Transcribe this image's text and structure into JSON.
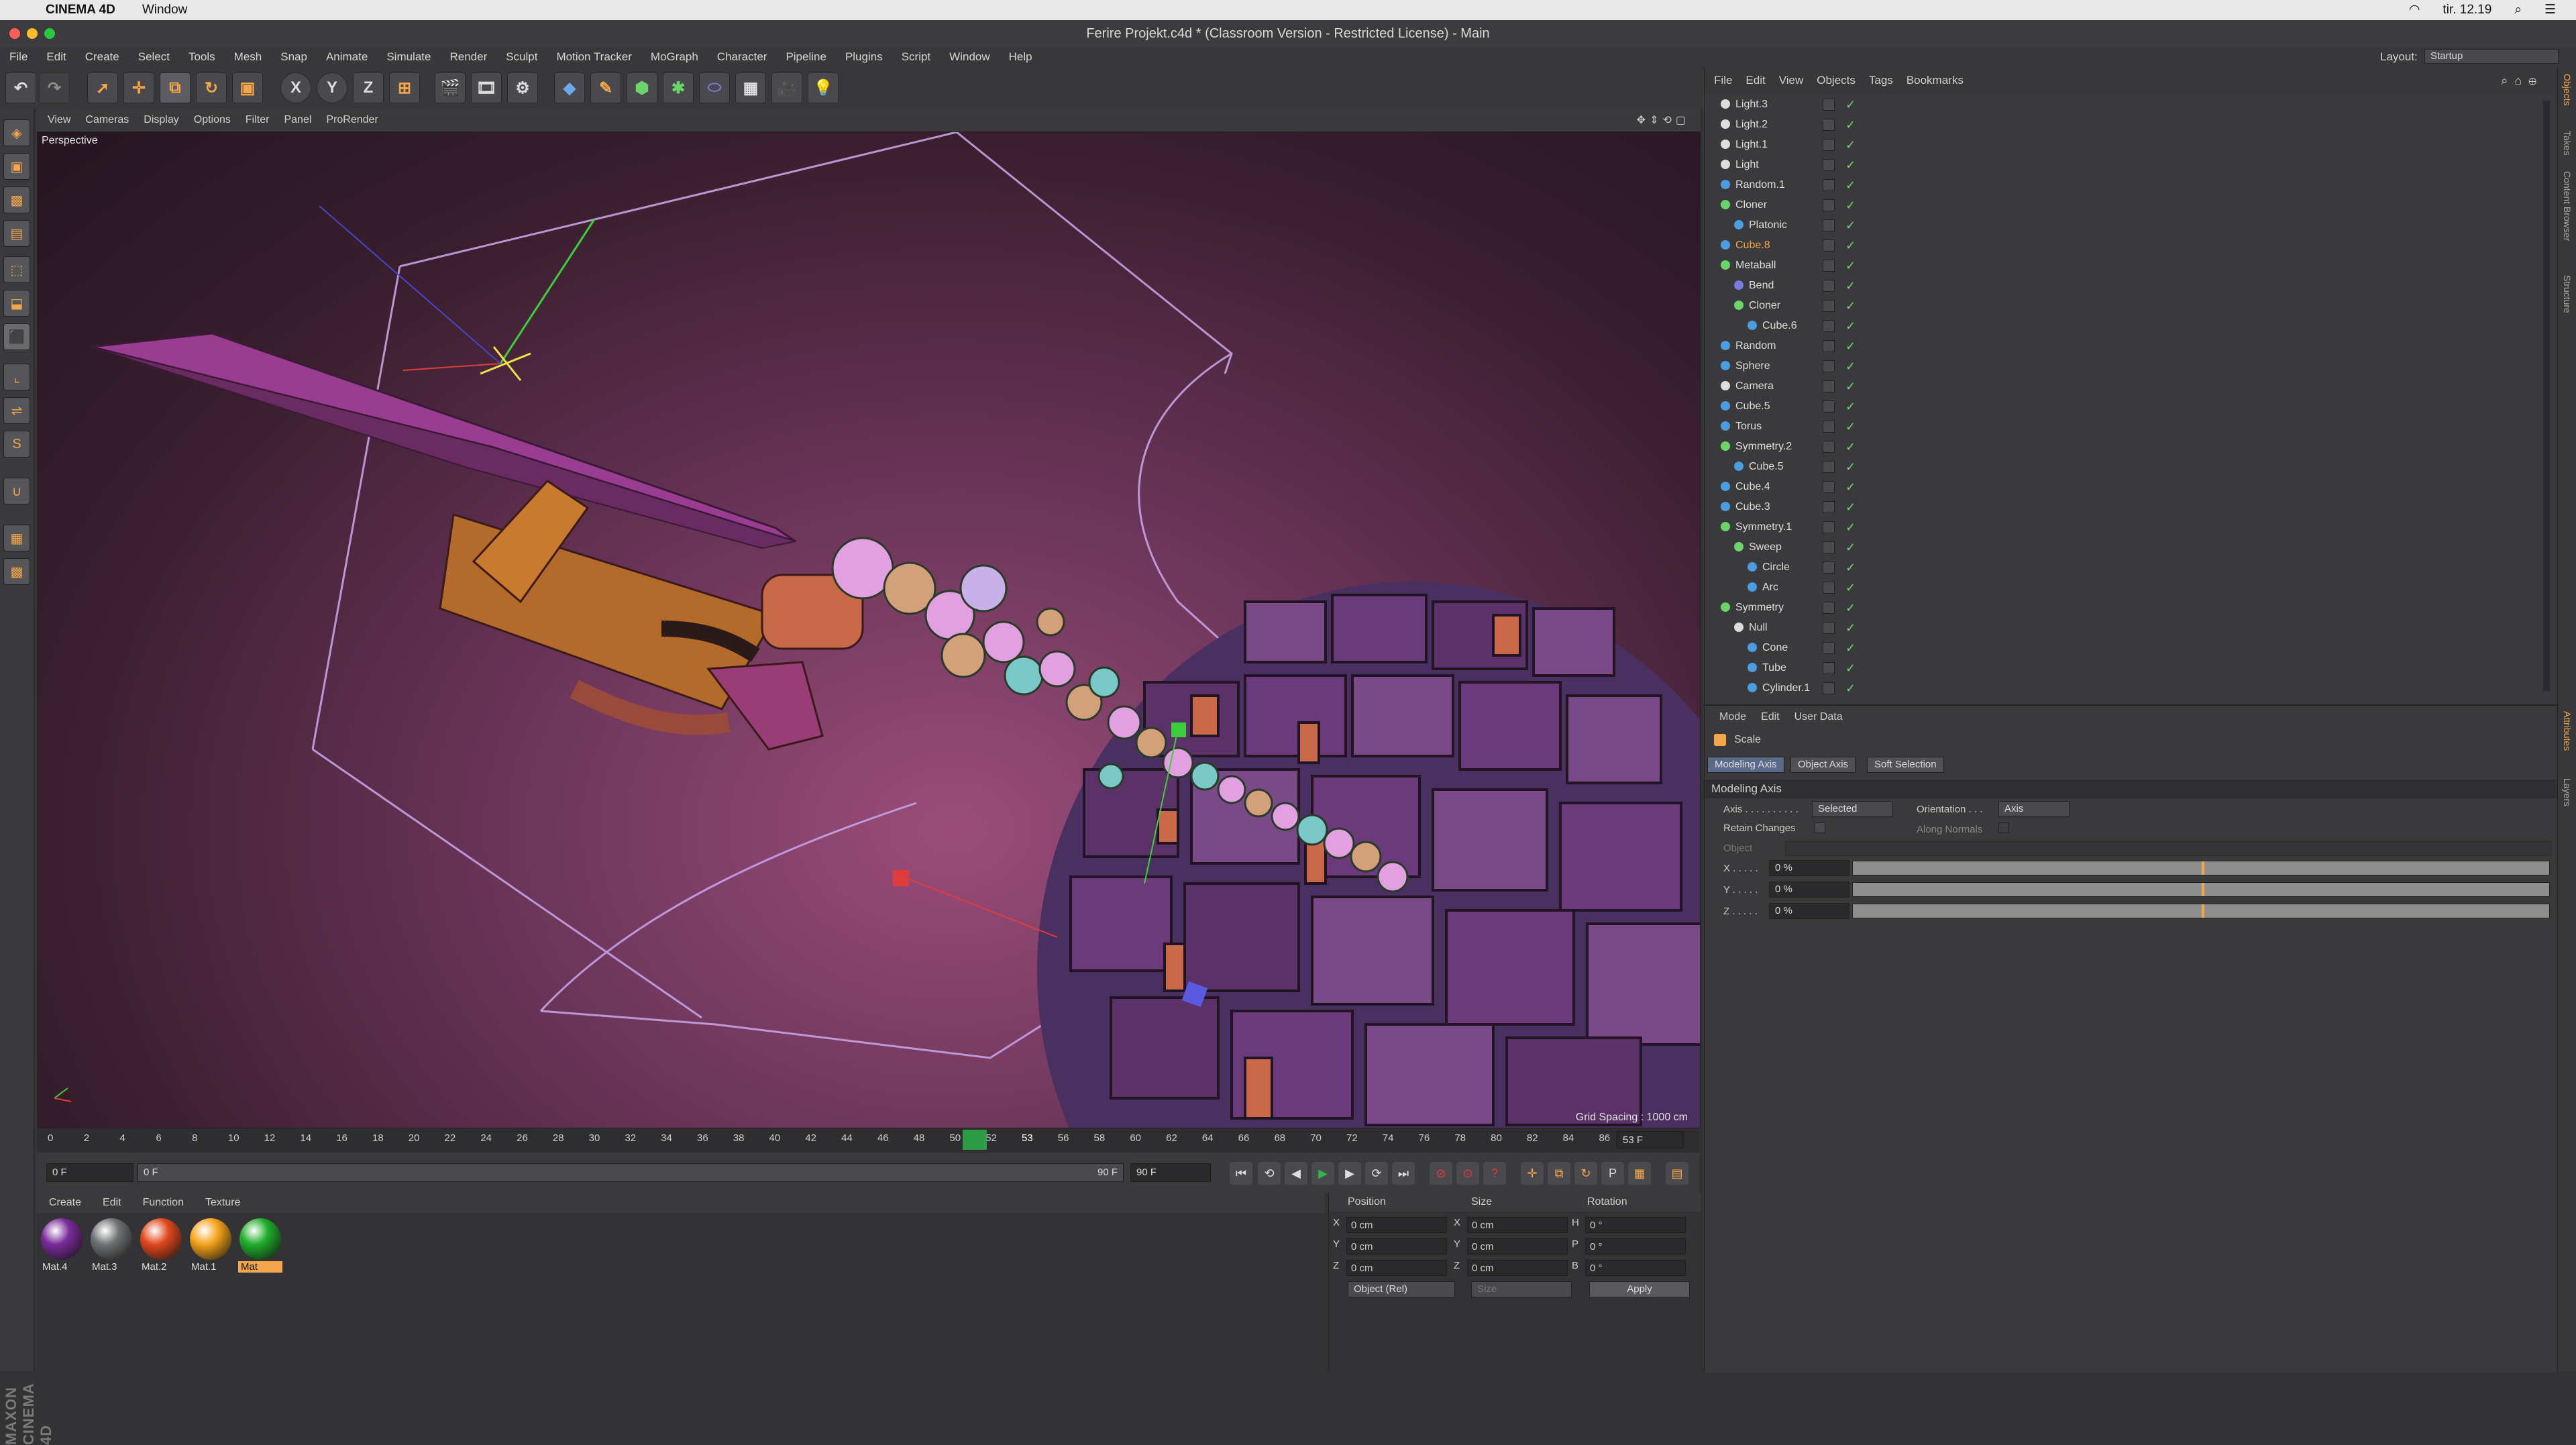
{
  "mac_menubar": {
    "app": "CINEMA 4D",
    "menu": "Window",
    "clock": "tir. 12.19"
  },
  "window": {
    "title": "Ferire Projekt.c4d * (Classroom Version - Restricted License) - Main"
  },
  "main_menu": [
    "File",
    "Edit",
    "Create",
    "Select",
    "Tools",
    "Mesh",
    "Snap",
    "Animate",
    "Simulate",
    "Render",
    "Sculpt",
    "Motion Tracker",
    "MoGraph",
    "Character",
    "Pipeline",
    "Plugins",
    "Script",
    "Window",
    "Help"
  ],
  "layout": {
    "label": "Layout:",
    "value": "Startup"
  },
  "toolbar_axes": [
    "X",
    "Y",
    "Z"
  ],
  "viewport": {
    "menu": [
      "View",
      "Cameras",
      "Display",
      "Options",
      "Filter",
      "Panel",
      "ProRender"
    ],
    "label": "Perspective",
    "grid_spacing": "Grid Spacing : 1000 cm"
  },
  "timeline": {
    "ticks": [
      "0",
      "2",
      "4",
      "6",
      "8",
      "10",
      "12",
      "14",
      "16",
      "18",
      "20",
      "22",
      "24",
      "26",
      "28",
      "30",
      "32",
      "34",
      "36",
      "38",
      "40",
      "42",
      "44",
      "46",
      "48",
      "50",
      "52",
      "53",
      "56",
      "58",
      "60",
      "62",
      "64",
      "66",
      "68",
      "70",
      "72",
      "74",
      "76",
      "78",
      "80",
      "82",
      "84",
      "86",
      "88",
      "90"
    ],
    "current_marker": "53",
    "current_frame": "53 F"
  },
  "transport": {
    "start": "0 F",
    "slider_start": "0 F",
    "slider_end": "90 F",
    "end": "90 F"
  },
  "material_panel": {
    "menu": [
      "Create",
      "Edit",
      "Function",
      "Texture"
    ],
    "materials": [
      {
        "name": "Mat.4",
        "color": "#7a2a9a"
      },
      {
        "name": "Mat.3",
        "color": "#6e7273"
      },
      {
        "name": "Mat.2",
        "color": "#e0481c"
      },
      {
        "name": "Mat.1",
        "color": "#f4a41a"
      },
      {
        "name": "Mat",
        "color": "#1fae2a"
      }
    ]
  },
  "coordinates": {
    "headers": [
      "Position",
      "Size",
      "Rotation"
    ],
    "rows": [
      {
        "axis": "X",
        "pos": "0 cm",
        "size_axis": "X",
        "size": "0 cm",
        "rot_axis": "H",
        "rot": "0 °"
      },
      {
        "axis": "Y",
        "pos": "0 cm",
        "size_axis": "Y",
        "size": "0 cm",
        "rot_axis": "P",
        "rot": "0 °"
      },
      {
        "axis": "Z",
        "pos": "0 cm",
        "size_axis": "Z",
        "size": "0 cm",
        "rot_axis": "B",
        "rot": "0 °"
      }
    ],
    "mode": "Object (Rel)",
    "size_mode": "Size",
    "apply": "Apply"
  },
  "object_manager": {
    "menu": [
      "File",
      "Edit",
      "View",
      "Objects",
      "Tags",
      "Bookmarks"
    ],
    "objects": [
      {
        "name": "Light.3",
        "depth": 0,
        "color": "#dddddd"
      },
      {
        "name": "Light.2",
        "depth": 0,
        "color": "#dddddd"
      },
      {
        "name": "Light.1",
        "depth": 0,
        "color": "#dddddd"
      },
      {
        "name": "Light",
        "depth": 0,
        "color": "#dddddd"
      },
      {
        "name": "Random.1",
        "depth": 0,
        "color": "#4a9ee0"
      },
      {
        "name": "Cloner",
        "depth": 0,
        "color": "#6bd46b"
      },
      {
        "name": "Platonic",
        "depth": 1,
        "color": "#4a9ee0"
      },
      {
        "name": "Cube.8",
        "depth": 0,
        "color": "#4a9ee0",
        "highlight": true
      },
      {
        "name": "Metaball",
        "depth": 0,
        "color": "#6bd46b"
      },
      {
        "name": "Bend",
        "depth": 1,
        "color": "#7a7ae0"
      },
      {
        "name": "Cloner",
        "depth": 1,
        "color": "#6bd46b"
      },
      {
        "name": "Cube.6",
        "depth": 2,
        "color": "#4a9ee0"
      },
      {
        "name": "Random",
        "depth": 0,
        "color": "#4a9ee0"
      },
      {
        "name": "Sphere",
        "depth": 0,
        "color": "#4a9ee0"
      },
      {
        "name": "Camera",
        "depth": 0,
        "color": "#dddddd"
      },
      {
        "name": "Cube.5",
        "depth": 0,
        "color": "#4a9ee0"
      },
      {
        "name": "Torus",
        "depth": 0,
        "color": "#4a9ee0"
      },
      {
        "name": "Symmetry.2",
        "depth": 0,
        "color": "#6bd46b"
      },
      {
        "name": "Cube.5",
        "depth": 1,
        "color": "#4a9ee0"
      },
      {
        "name": "Cube.4",
        "depth": 0,
        "color": "#4a9ee0"
      },
      {
        "name": "Cube.3",
        "depth": 0,
        "color": "#4a9ee0"
      },
      {
        "name": "Symmetry.1",
        "depth": 0,
        "color": "#6bd46b"
      },
      {
        "name": "Sweep",
        "depth": 1,
        "color": "#6bd46b"
      },
      {
        "name": "Circle",
        "depth": 2,
        "color": "#4a9ee0"
      },
      {
        "name": "Arc",
        "depth": 2,
        "color": "#4a9ee0"
      },
      {
        "name": "Symmetry",
        "depth": 0,
        "color": "#6bd46b"
      },
      {
        "name": "Null",
        "depth": 1,
        "color": "#dddddd"
      },
      {
        "name": "Cone",
        "depth": 2,
        "color": "#4a9ee0"
      },
      {
        "name": "Tube",
        "depth": 2,
        "color": "#4a9ee0"
      },
      {
        "name": "Cylinder.1",
        "depth": 2,
        "color": "#4a9ee0"
      }
    ]
  },
  "attributes": {
    "menu": [
      "Mode",
      "Edit",
      "User Data"
    ],
    "tool": "Scale",
    "tabs": [
      "Modeling Axis",
      "Object Axis",
      "Soft Selection"
    ],
    "section": "Modeling Axis",
    "axis_label": "Axis . . . . . . . . . .",
    "axis_value": "Selected",
    "orientation_label": "Orientation . . .",
    "orientation_value": "Axis",
    "retain_changes": "Retain Changes",
    "along_normals": "Along Normals",
    "object_label": "Object",
    "x_label": "X . . . . .",
    "y_label": "Y . . . . .",
    "z_label": "Z . . . . .",
    "x_value": "0 %",
    "y_value": "0 %",
    "z_value": "0 %"
  },
  "right_strip": [
    "Objects",
    "Takes",
    "Content Browser",
    "Structure",
    "Attributes",
    "Layers"
  ],
  "maxon_logo": "MAXON CINEMA 4D"
}
